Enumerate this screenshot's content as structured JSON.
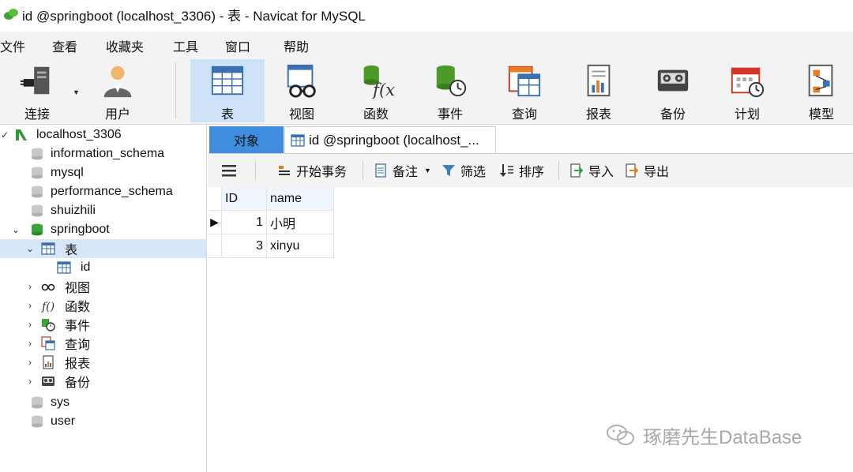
{
  "window": {
    "title": "id @springboot (localhost_3306) - 表 - Navicat for MySQL"
  },
  "menu": [
    {
      "label": "文件"
    },
    {
      "label": "查看"
    },
    {
      "label": "收藏夹"
    },
    {
      "label": "工具"
    },
    {
      "label": "窗口"
    },
    {
      "label": "帮助"
    }
  ],
  "toolbar": {
    "items": [
      {
        "label": "连接",
        "icon": "plug-connection-icon"
      },
      {
        "label": "用户",
        "icon": "user-icon"
      },
      {
        "label": "表",
        "icon": "table-icon",
        "active": true
      },
      {
        "label": "视图",
        "icon": "view-glasses-icon"
      },
      {
        "label": "函数",
        "icon": "function-icon"
      },
      {
        "label": "事件",
        "icon": "event-clock-icon"
      },
      {
        "label": "查询",
        "icon": "query-icon"
      },
      {
        "label": "报表",
        "icon": "report-icon"
      },
      {
        "label": "备份",
        "icon": "backup-tape-icon"
      },
      {
        "label": "计划",
        "icon": "schedule-calendar-icon"
      },
      {
        "label": "模型",
        "icon": "model-icon"
      }
    ]
  },
  "sidebar": {
    "connection": "localhost_3306",
    "databases": [
      {
        "label": "information_schema"
      },
      {
        "label": "mysql"
      },
      {
        "label": "performance_schema"
      },
      {
        "label": "shuizhili"
      },
      {
        "label": "springboot"
      }
    ],
    "springboot_children": {
      "tables_label": "表",
      "table_id": "id",
      "groups": [
        {
          "label": "视图",
          "icon": "view-glasses-icon"
        },
        {
          "label": "函数",
          "icon": "function-icon"
        },
        {
          "label": "事件",
          "icon": "event-clock-icon"
        },
        {
          "label": "查询",
          "icon": "query-icon"
        },
        {
          "label": "报表",
          "icon": "report-icon"
        },
        {
          "label": "备份",
          "icon": "backup-tape-icon"
        }
      ]
    },
    "more_databases": [
      {
        "label": "sys"
      },
      {
        "label": "user"
      }
    ]
  },
  "tabs": {
    "objects": "对象",
    "table_tab": "id @springboot (localhost_..."
  },
  "subtoolbar": {
    "begin_transaction": "开始事务",
    "memo": "备注",
    "filter": "筛选",
    "sort": "排序",
    "import": "导入",
    "export": "导出"
  },
  "grid": {
    "columns": [
      "ID",
      "name"
    ],
    "rows": [
      {
        "ID": "1",
        "name": "小明"
      },
      {
        "ID": "3",
        "name": "xinyu"
      }
    ]
  },
  "watermark": "琢磨先生DataBase",
  "colors": {
    "accent_active_tab": "#3e8edd",
    "selection": "#d6e7f8",
    "toolbar_bg": "#f3f3f3"
  }
}
